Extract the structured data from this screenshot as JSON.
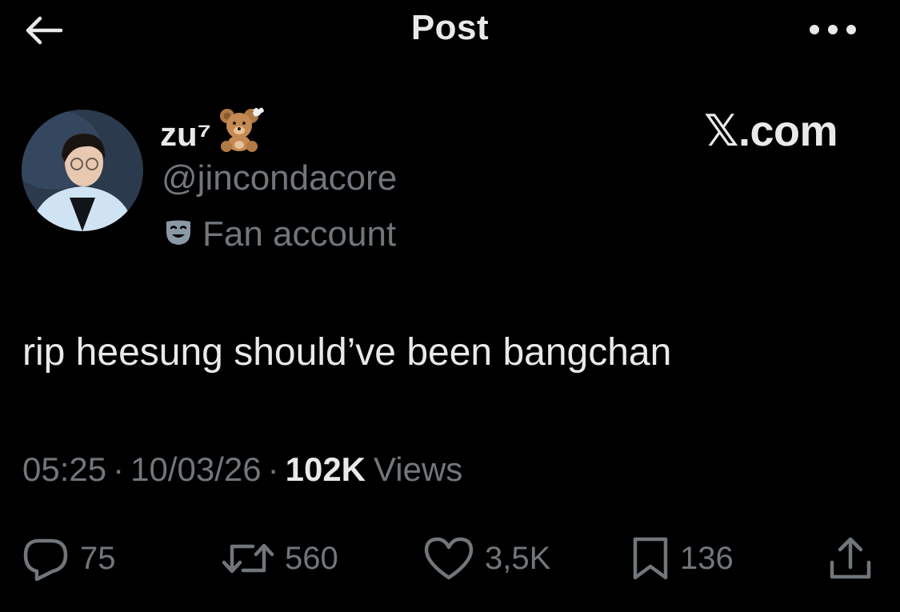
{
  "header": {
    "title": "Post",
    "back_icon": "arrow-left-icon",
    "more_icon": "more-horizontal-icon"
  },
  "author": {
    "name": "zu⁷",
    "name_emoji": "teddy-bear-with-bandage",
    "handle": "@jincondacore",
    "badge_icon": "theater-mask-icon",
    "badge_label": "Fan account"
  },
  "watermark": "𝕏.com",
  "post": {
    "text": "rip heesung should’ve been bangchan",
    "time": "05:25",
    "date": "10/03/26",
    "separator": "·",
    "views_count": "102K",
    "views_label": "Views"
  },
  "actions": {
    "replies": "75",
    "reposts": "560",
    "likes": "3,5K",
    "bookmarks": "136"
  },
  "colors": {
    "background": "#000000",
    "primary_text": "#e7e9ea",
    "secondary_text": "#71767b"
  }
}
